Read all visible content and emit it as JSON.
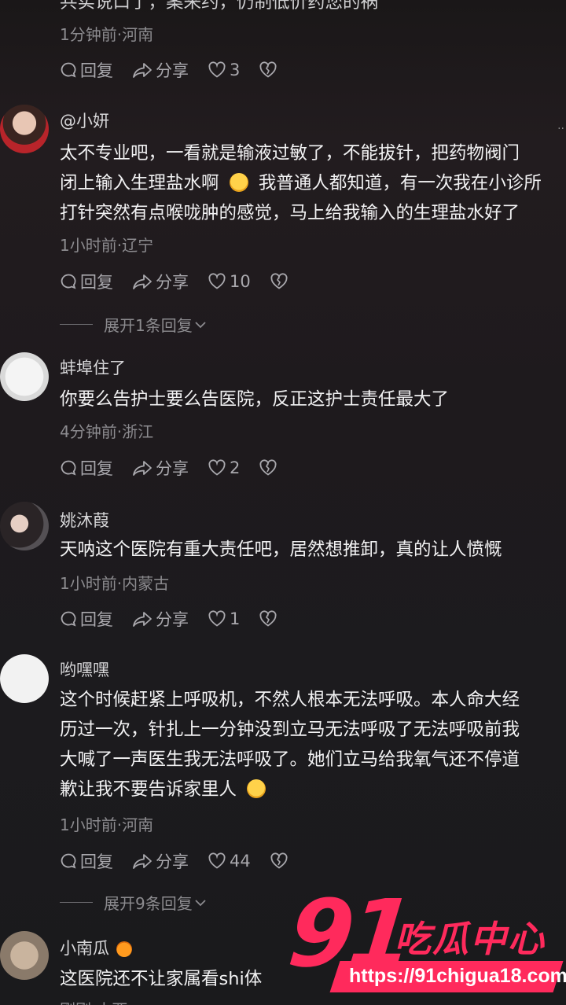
{
  "comments": [
    {
      "name": "",
      "lines": [
        "共实说口了，案来约，仍制低价药您的祸"
      ],
      "meta": "1分钟前·河南",
      "reply": "回复",
      "share": "分享",
      "likes": "3",
      "expand": ""
    },
    {
      "name": "@小妍",
      "lines": [
        "太不专业吧，一看就是输液过敏了，不能拔针，把药物阀门",
        "闭上输入生理盐水啊",
        "我普通人都知道，有一次我在小诊所",
        "打针突然有点喉咙肿的感觉，马上给我输入的生理盐水好了"
      ],
      "meta": "1小时前·辽宁",
      "reply": "回复",
      "share": "分享",
      "likes": "10",
      "expand": "展开1条回复"
    },
    {
      "name": "蚌埠住了",
      "lines": [
        "你要么告护士要么告医院，反正这护士责任最大了"
      ],
      "meta": "4分钟前·浙江",
      "reply": "回复",
      "share": "分享",
      "likes": "2",
      "expand": ""
    },
    {
      "name": "姚沐葭",
      "lines": [
        "天呐这个医院有重大责任吧，居然想推卸，真的让人愤慨"
      ],
      "meta": "1小时前·内蒙古",
      "reply": "回复",
      "share": "分享",
      "likes": "1",
      "expand": ""
    },
    {
      "name": "哟嘿嘿",
      "lines": [
        "这个时候赶紧上呼吸机，不然人根本无法呼吸。本人命大经",
        "历过一次，针扎上一分钟没到立马无法呼吸了无法呼吸前我",
        "大喊了一声医生我无法呼吸了。她们立马给我氧气还不停道",
        "歉让我不要告诉家里人"
      ],
      "meta": "1小时前·河南",
      "reply": "回复",
      "share": "分享",
      "likes": "44",
      "expand": "展开9条回复"
    },
    {
      "name": "小南瓜",
      "lines": [
        "这医院还不让家属看shi体"
      ],
      "meta": "刚刚·山西",
      "reply": "",
      "share": "",
      "likes": "",
      "expand": ""
    }
  ],
  "watermark": {
    "number": "91",
    "brand": "吃瓜中心",
    "url": "https://91chigua18.com"
  },
  "colors": {
    "accent": "#ff2a5c",
    "background": "#1b1a1c"
  }
}
